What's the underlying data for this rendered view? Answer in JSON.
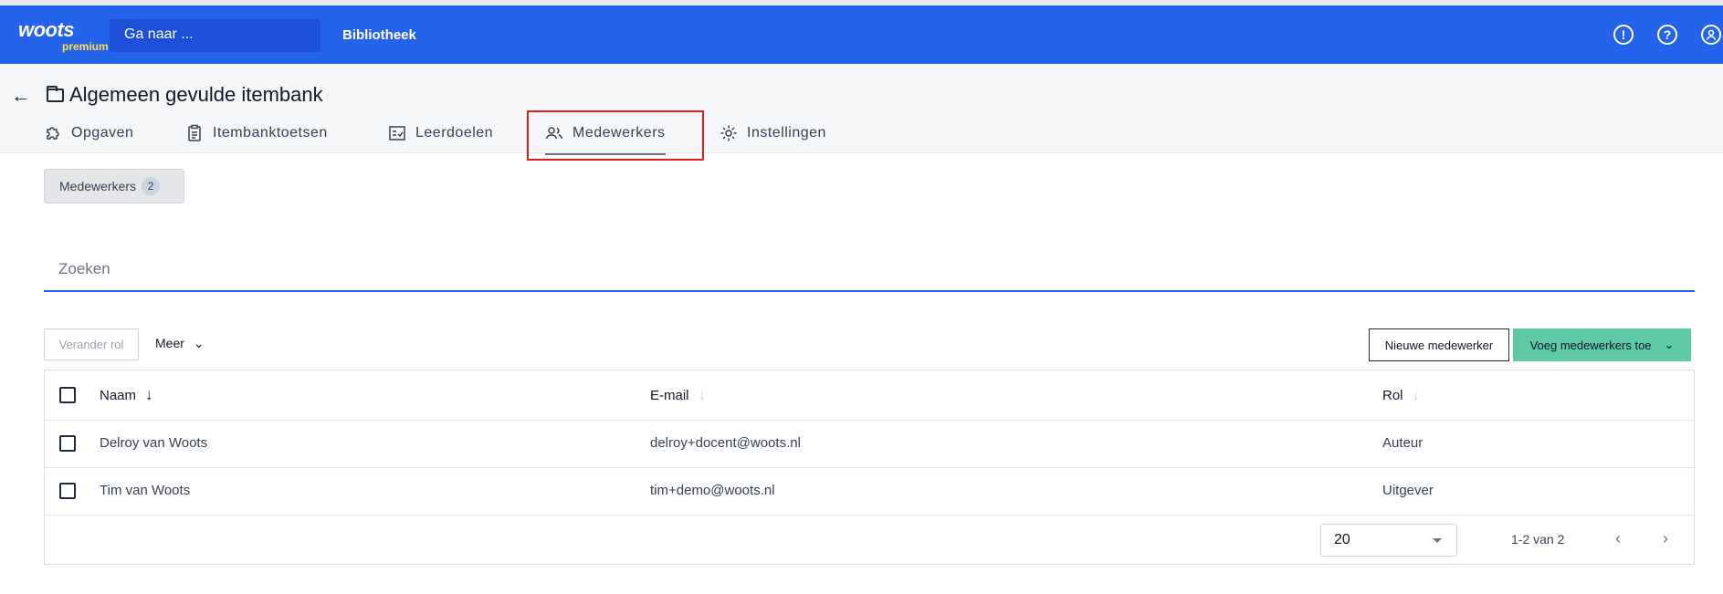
{
  "header": {
    "logo_text": "woots",
    "logo_sub": "premium",
    "goto_placeholder": "Ga naar ...",
    "library_link": "Bibliotheek",
    "icons": [
      "alert-icon",
      "help-icon",
      "account-icon"
    ]
  },
  "page": {
    "title": "Algemeen gevulde itembank",
    "tabs": [
      {
        "label": "Opgaven",
        "icon": "puzzle-icon"
      },
      {
        "label": "Itembanktoetsen",
        "icon": "clipboard-icon"
      },
      {
        "label": "Leerdoelen",
        "icon": "checklist-icon"
      },
      {
        "label": "Medewerkers",
        "icon": "people-icon",
        "active": true
      },
      {
        "label": "Instellingen",
        "icon": "gear-icon"
      }
    ]
  },
  "filter": {
    "label": "Medewerkers",
    "count": "2"
  },
  "search": {
    "placeholder": "Zoeken"
  },
  "toolbar": {
    "change_role": "Verander rol",
    "more": "Meer",
    "new_member": "Nieuwe medewerker",
    "add_members": "Voeg medewerkers toe"
  },
  "table": {
    "columns": [
      "Naam",
      "E-mail",
      "Rol"
    ],
    "rows": [
      {
        "name": "Delroy van Woots",
        "email": "delroy+docent@woots.nl",
        "role": "Auteur"
      },
      {
        "name": "Tim van Woots",
        "email": "tim+demo@woots.nl",
        "role": "Uitgever"
      }
    ]
  },
  "pagination": {
    "per_page": "20",
    "range": "1-2 van 2"
  },
  "colors": {
    "brand": "#2563eb",
    "accent": "#5ec9a4",
    "highlight": "#e11d1d"
  }
}
